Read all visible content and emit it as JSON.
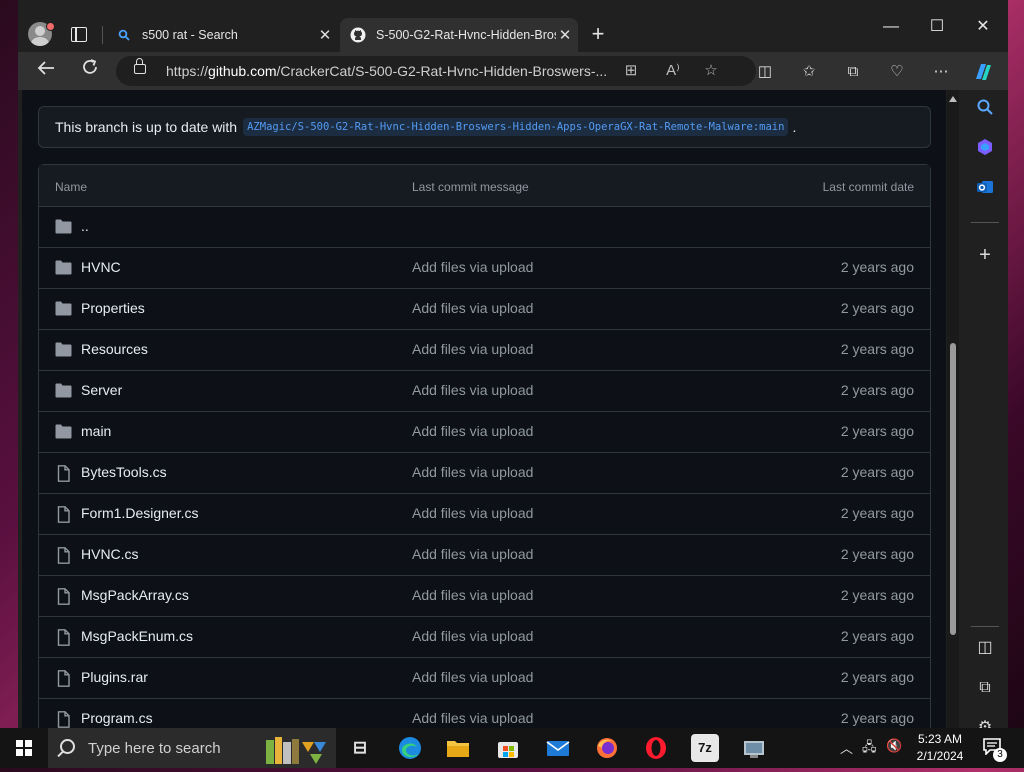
{
  "browser": {
    "tabs": [
      {
        "title": "s500 rat - Search",
        "icon": "bing-search-icon"
      },
      {
        "title": "S-500-G2-Rat-Hvnc-Hidden-Bros",
        "icon": "github-icon"
      }
    ],
    "url_prefix": "https://",
    "url_host": "github.com",
    "url_path": "/CrackerCat/S-500-G2-Rat-Hvnc-Hidden-Broswers-..."
  },
  "page": {
    "branch_text": "This branch is up to date with",
    "branch_ref": "AZMagic/S-500-G2-Rat-Hvnc-Hidden-Broswers-Hidden-Apps-OperaGX-Rat-Remote-Malware:main",
    "branch_suffix": ".",
    "columns": {
      "name": "Name",
      "message": "Last commit message",
      "date": "Last commit date"
    },
    "rows": [
      {
        "name": "..",
        "type": "folder",
        "message": "",
        "date": ""
      },
      {
        "name": "HVNC",
        "type": "folder",
        "message": "Add files via upload",
        "date": "2 years ago"
      },
      {
        "name": "Properties",
        "type": "folder",
        "message": "Add files via upload",
        "date": "2 years ago"
      },
      {
        "name": "Resources",
        "type": "folder",
        "message": "Add files via upload",
        "date": "2 years ago"
      },
      {
        "name": "Server",
        "type": "folder",
        "message": "Add files via upload",
        "date": "2 years ago"
      },
      {
        "name": "main",
        "type": "folder",
        "message": "Add files via upload",
        "date": "2 years ago"
      },
      {
        "name": "BytesTools.cs",
        "type": "file",
        "message": "Add files via upload",
        "date": "2 years ago"
      },
      {
        "name": "Form1.Designer.cs",
        "type": "file",
        "message": "Add files via upload",
        "date": "2 years ago"
      },
      {
        "name": "HVNC.cs",
        "type": "file",
        "message": "Add files via upload",
        "date": "2 years ago"
      },
      {
        "name": "MsgPackArray.cs",
        "type": "file",
        "message": "Add files via upload",
        "date": "2 years ago"
      },
      {
        "name": "MsgPackEnum.cs",
        "type": "file",
        "message": "Add files via upload",
        "date": "2 years ago"
      },
      {
        "name": "Plugins.rar",
        "type": "file",
        "message": "Add files via upload",
        "date": "2 years ago"
      },
      {
        "name": "Program.cs",
        "type": "file",
        "message": "Add files via upload",
        "date": "2 years ago"
      }
    ]
  },
  "taskbar": {
    "search_placeholder": "Type here to search",
    "apps": [
      "task-view-icon",
      "edge-icon",
      "file-explorer-icon",
      "store-icon",
      "mail-icon",
      "firefox-icon",
      "opera-icon",
      "7zip-icon",
      "app-icon"
    ],
    "seven_zip_label": "7z",
    "time": "5:23 AM",
    "date": "2/1/2024",
    "notification_count": "3"
  },
  "colors": {
    "page_bg": "#0d1117",
    "link": "#539bf5",
    "text": "#e6edf3",
    "muted": "#9198a1",
    "border": "#30363d"
  }
}
